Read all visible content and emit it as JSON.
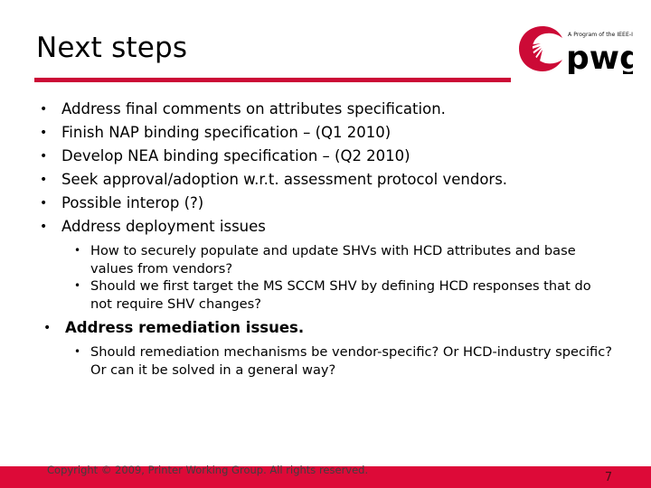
{
  "slide": {
    "title": "Next steps",
    "accent_color": "#CC0A36",
    "footer_bar_color": "#DD0A38"
  },
  "logo": {
    "wordmark": "pwg",
    "tagline": "A Program of the IEEE-ISTO",
    "mark_color": "#CC0A36",
    "wordmark_color": "#000000"
  },
  "bullets": {
    "b1": "Address final comments on attributes specification.",
    "b2": "Finish NAP binding specification – (Q1 2010)",
    "b3": "Develop NEA binding specification – (Q2 2010)",
    "b4": "Seek approval/adoption w.r.t. assessment protocol vendors.",
    "b5": "Possible interop (?)",
    "b6": "Address deployment issues",
    "b6s1": "How to securely populate and update SHVs with HCD attributes and base values from vendors?",
    "b6s2": "Should we first target the MS SCCM SHV by defining HCD responses that do not require SHV changes?",
    "b7": "Address remediation issues.",
    "b7s1": "Should remediation mechanisms be vendor-specific? Or HCD-industry specific? Or can it be solved in a general way?"
  },
  "marks": {
    "bullet_glyph": "•"
  },
  "footer": {
    "copyright": "Copyright © 2009, Printer Working Group. All rights reserved.",
    "page_number": "7"
  }
}
